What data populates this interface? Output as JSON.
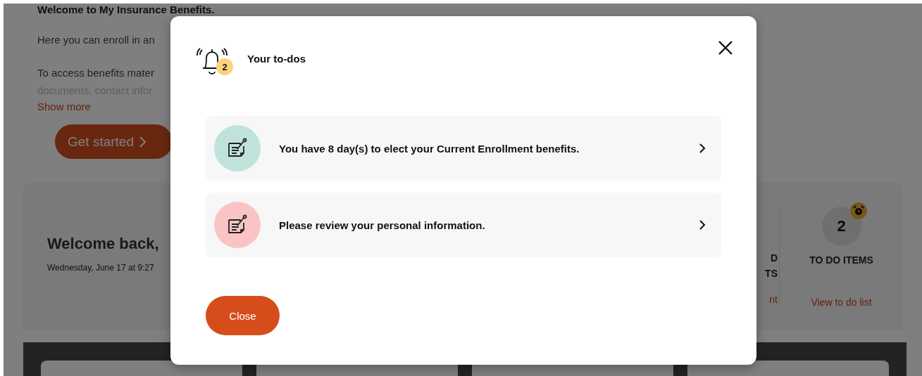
{
  "background": {
    "heading": "Welcome to My Insurance Benefits.",
    "intro": "Here you can enroll in an",
    "access_lines": [
      "To access benefits mater",
      "documents, contact infor"
    ],
    "show_more": "Show more",
    "get_started": "Get started",
    "welcome": "Welcome back,",
    "date": "Wednesday, June 17 at 9:27",
    "hidden_column": [
      "D",
      "TS",
      "nt"
    ],
    "todo_count": "2",
    "todo_label": "TO DO ITEMS",
    "todo_link": "View to do list"
  },
  "modal": {
    "title": "Your to-dos",
    "badge": "2",
    "items": [
      {
        "text": "You have 8 day(s) to elect your Current Enrollment benefits.",
        "color": "#bfe3da"
      },
      {
        "text": "Please review your personal information.",
        "color": "#fbc4c4"
      }
    ],
    "close_button": "Close"
  }
}
